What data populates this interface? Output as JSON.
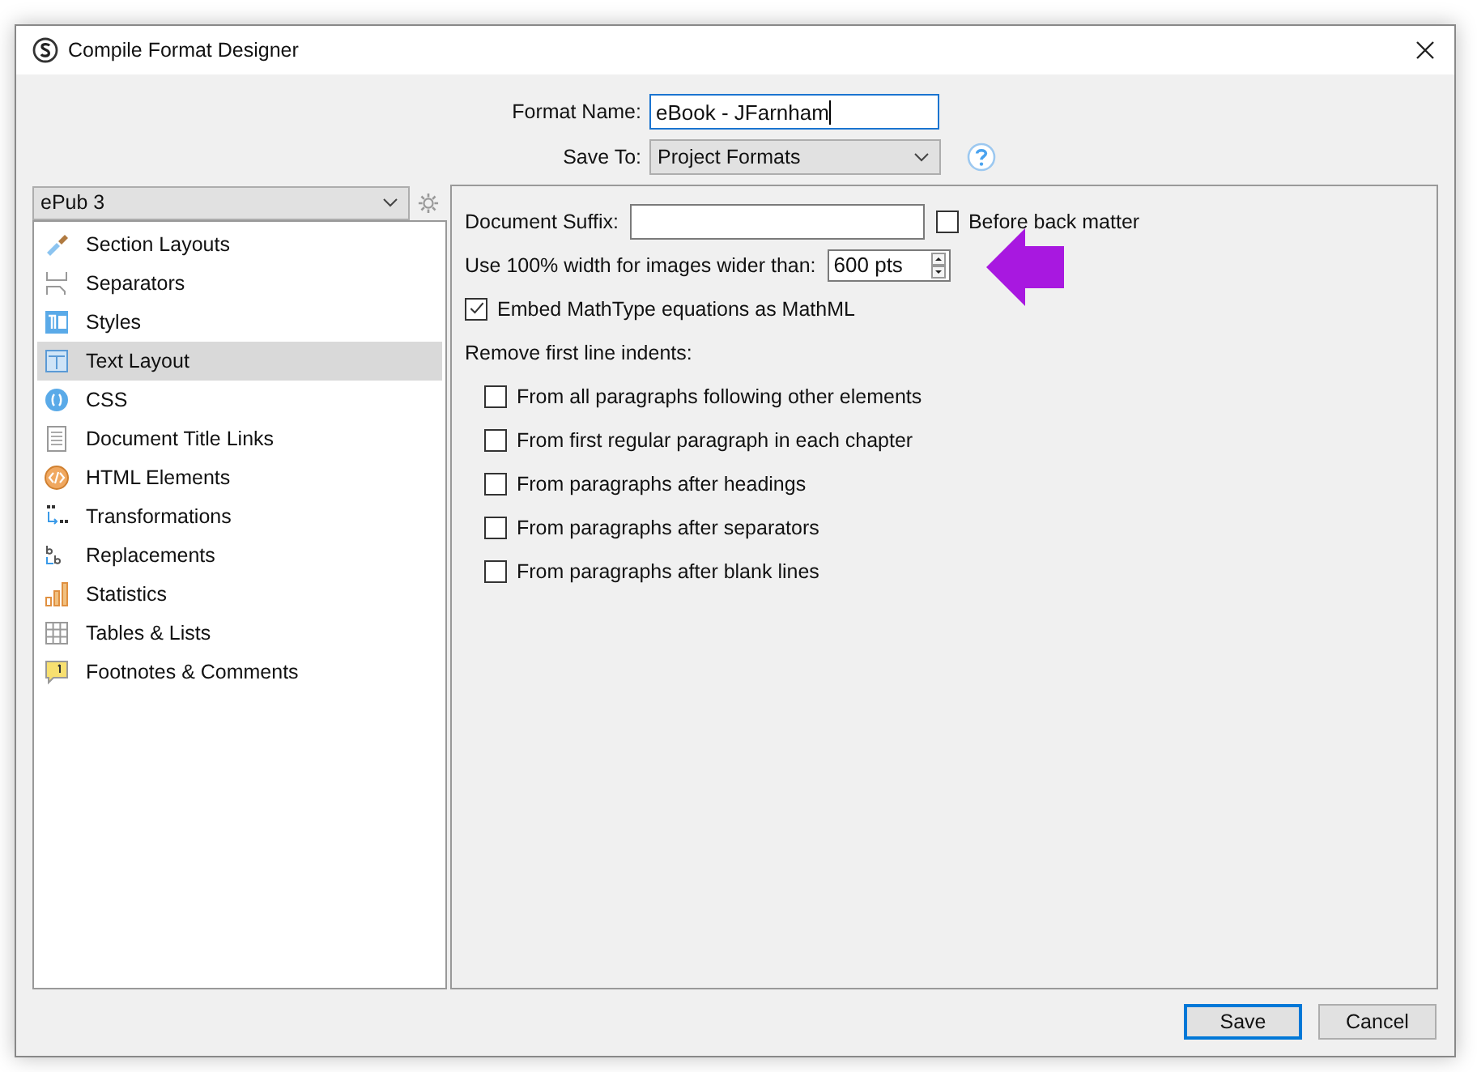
{
  "window": {
    "title": "Compile Format Designer"
  },
  "format_name": {
    "label": "Format Name:",
    "value": "eBook - JFarnham"
  },
  "save_to": {
    "label": "Save To:",
    "value": "Project Formats"
  },
  "format_selector": {
    "value": "ePub 3"
  },
  "sidebar": {
    "items": [
      {
        "label": "Section Layouts",
        "selected": false
      },
      {
        "label": "Separators",
        "selected": false
      },
      {
        "label": "Styles",
        "selected": false
      },
      {
        "label": "Text Layout",
        "selected": true
      },
      {
        "label": "CSS",
        "selected": false
      },
      {
        "label": "Document Title Links",
        "selected": false
      },
      {
        "label": "HTML Elements",
        "selected": false
      },
      {
        "label": "Transformations",
        "selected": false
      },
      {
        "label": "Replacements",
        "selected": false
      },
      {
        "label": "Statistics",
        "selected": false
      },
      {
        "label": "Tables & Lists",
        "selected": false
      },
      {
        "label": "Footnotes & Comments",
        "selected": false
      }
    ]
  },
  "document_suffix": {
    "label": "Document Suffix:"
  },
  "before_back_matter": {
    "label": "Before back matter",
    "checked": false
  },
  "image_width": {
    "label": "Use 100% width for images wider than:",
    "value": "600 pts"
  },
  "embed_mathtype": {
    "label": "Embed MathType equations as MathML",
    "checked": true
  },
  "remove_indents": {
    "label": "Remove first line indents:",
    "options": [
      {
        "label": "From all paragraphs following other elements",
        "checked": false
      },
      {
        "label": "From first regular paragraph in each chapter",
        "checked": false
      },
      {
        "label": "From paragraphs after headings",
        "checked": false
      },
      {
        "label": "From paragraphs after separators",
        "checked": false
      },
      {
        "label": "From paragraphs after blank lines",
        "checked": false
      }
    ]
  },
  "buttons": [
    {
      "label": "Save",
      "default": true
    },
    {
      "label": "Cancel",
      "default": false
    }
  ]
}
